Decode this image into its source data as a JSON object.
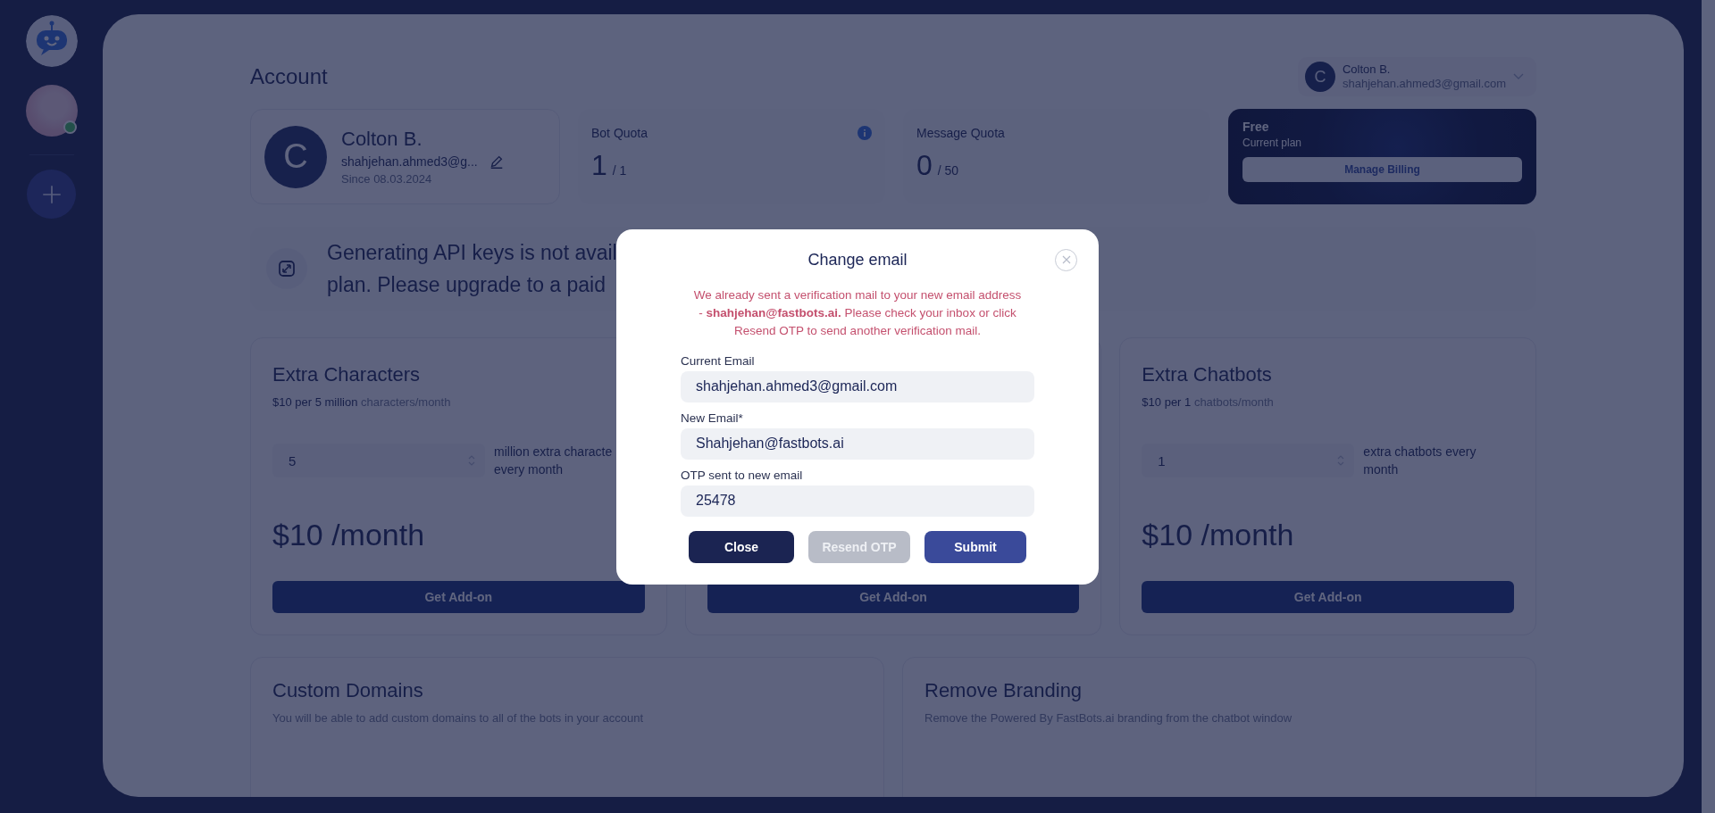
{
  "sidebar": {
    "bots": [
      {
        "kind": "robot",
        "online": false
      },
      {
        "kind": "photo",
        "online": true
      }
    ]
  },
  "header": {
    "title": "Account",
    "user_menu": {
      "initial": "C",
      "name": "Colton B.",
      "email": "shahjehan.ahmed3@gmail.com"
    }
  },
  "profile_card": {
    "initial": "C",
    "name": "Colton B.",
    "email": "shahjehan.ahmed3@g...",
    "since": "Since 08.03.2024"
  },
  "quotas": [
    {
      "label": "Bot Quota",
      "value": "1",
      "limit": "/ 1",
      "info": true
    },
    {
      "label": "Message Quota",
      "value": "0",
      "limit": "/ 50",
      "info": false
    }
  ],
  "plan": {
    "name": "Free",
    "caption": "Current plan",
    "button": "Manage Billing"
  },
  "api_notice": {
    "lines": [
      "Generating API keys is not avail",
      "plan. Please upgrade to a paid"
    ]
  },
  "addons": [
    {
      "title": "Extra Characters",
      "price_line": "$10 per 5 million",
      "unit": "characters/month",
      "quantity": "5",
      "quantity_label": [
        "million extra characte",
        "every month"
      ],
      "price": "$10 /month",
      "button": "Get Add-on"
    },
    {
      "button": "Get Add-on"
    },
    {
      "title": "Extra Chatbots",
      "price_line": "$10 per 1",
      "unit": "chatbots/month",
      "quantity": "1",
      "quantity_label": [
        "extra chatbots every",
        "month"
      ],
      "price": "$10 /month",
      "button": "Get Add-on"
    }
  ],
  "features": [
    {
      "title": "Custom Domains",
      "description": "You will be able to add custom domains to all of the bots in your account"
    },
    {
      "title": "Remove Branding",
      "description": "Remove the Powered By FastBots.ai branding from the chatbot window"
    }
  ],
  "modal": {
    "title": "Change email",
    "message": "We already sent a verification mail to your new email address - **shahjehan@fastbots.ai.** Please check your inbox or click Resend OTP to send another verification mail.",
    "fields": [
      {
        "label": "Current Email",
        "value": "shahjehan.ahmed3@gmail.com"
      },
      {
        "label": "New Email*",
        "value": "Shahjehan@fastbots.ai"
      },
      {
        "label": "OTP sent to new email",
        "value": "25478"
      }
    ],
    "buttons": [
      {
        "label": "Close",
        "kind": "dark",
        "disabled": false
      },
      {
        "label": "Resend OTP",
        "kind": "outline",
        "disabled": true
      },
      {
        "label": "Submit",
        "kind": "primary",
        "disabled": false
      }
    ]
  }
}
